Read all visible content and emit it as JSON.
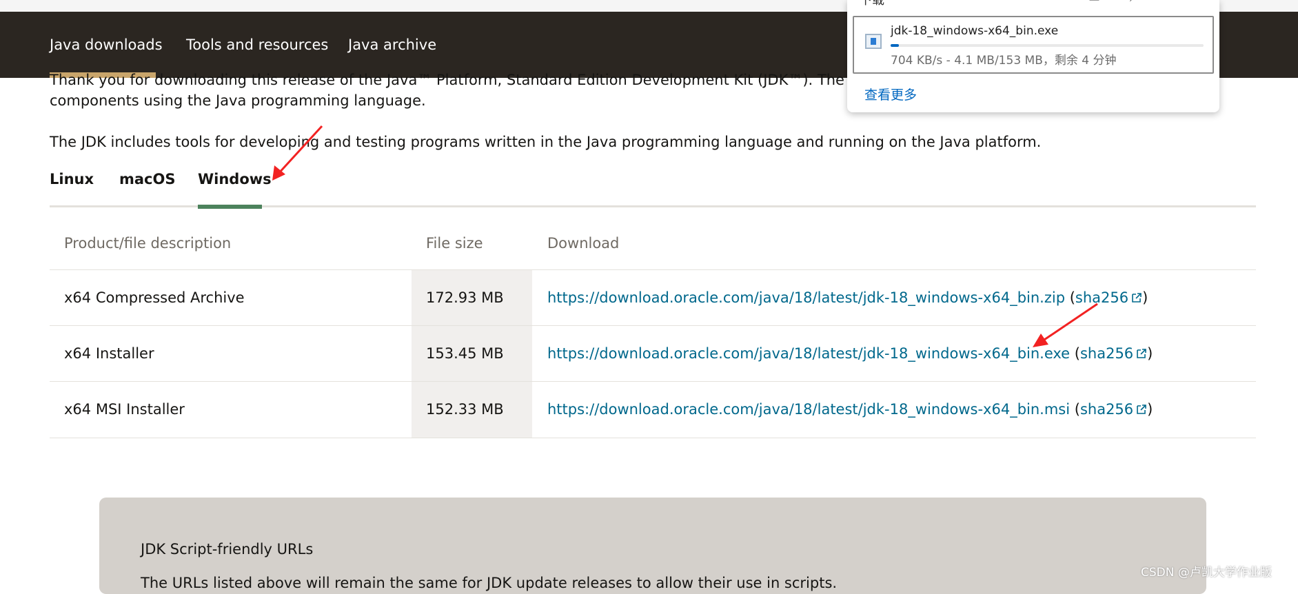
{
  "nav": {
    "items": [
      "Java downloads",
      "Tools and resources",
      "Java archive"
    ],
    "active_index": 0
  },
  "intro": {
    "line1": "Thank you for downloading this release of the Java™ Platform, Standard Edition Development Kit (JDK™). The JDK is a d",
    "line2": "components using the Java programming language.",
    "line3": "The JDK includes tools for developing and testing programs written in the Java programming language and running on the Java platform."
  },
  "tabs": {
    "items": [
      "Linux",
      "macOS",
      "Windows"
    ],
    "active": "Windows"
  },
  "table": {
    "headers": [
      "Product/file description",
      "File size",
      "Download"
    ],
    "rows": [
      {
        "description": "x64 Compressed Archive",
        "size": "172.93 MB",
        "url": "https://download.oracle.com/java/18/latest/jdk-18_windows-x64_bin.zip",
        "checksum": "sha256"
      },
      {
        "description": "x64 Installer",
        "size": "153.45 MB",
        "url": "https://download.oracle.com/java/18/latest/jdk-18_windows-x64_bin.exe",
        "checksum": "sha256"
      },
      {
        "description": "x64 MSI Installer",
        "size": "152.33 MB",
        "url": "https://download.oracle.com/java/18/latest/jdk-18_windows-x64_bin.msi",
        "checksum": "sha256"
      }
    ]
  },
  "script_box": {
    "title": "JDK Script-friendly URLs",
    "subtitle": "The URLs listed above will remain the same for JDK update releases to allow their use in scripts."
  },
  "download_popup": {
    "filename": "jdk-18_windows-x64_bin.exe",
    "status": "704 KB/s - 4.1 MB/153 MB，剩余 4 分钟",
    "progress": 0.027,
    "see_more": "查看更多"
  },
  "watermark": "CSDN @卢凯大学作业版",
  "colors": {
    "nav_bg": "#2b2621",
    "link": "#00688c",
    "tab_active": "#4c825c",
    "annotation_arrow": "#f22222"
  }
}
